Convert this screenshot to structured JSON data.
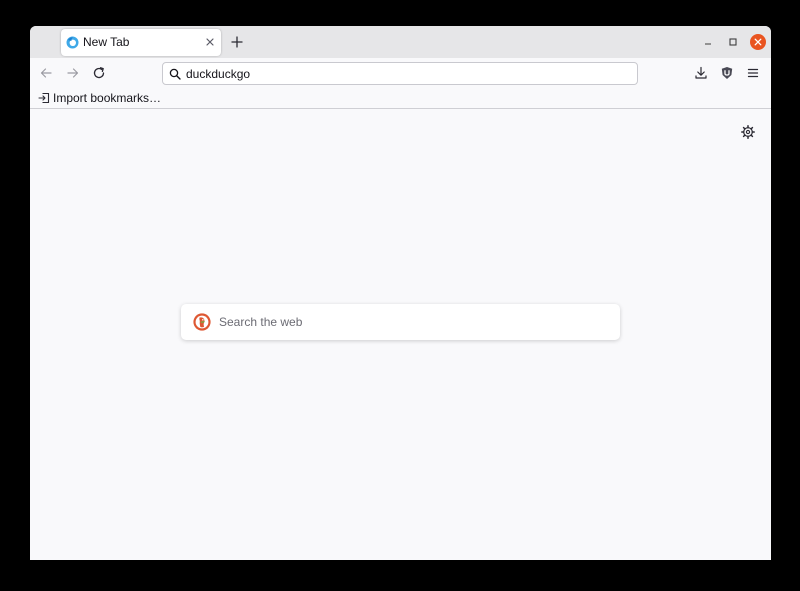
{
  "tab": {
    "title": "New Tab"
  },
  "urlbar": {
    "value": "duckduckgo"
  },
  "bookmarks": {
    "import_label": "Import bookmarks…"
  },
  "search": {
    "placeholder": "Search the web"
  },
  "icons": {
    "favicon": "firefox-icon",
    "tab_close": "close-icon",
    "new_tab": "plus-icon",
    "back": "arrow-left-icon",
    "forward": "arrow-right-icon",
    "reload": "reload-icon",
    "url_search": "search-icon",
    "download": "download-icon",
    "extension": "shield-icon",
    "menu": "hamburger-menu-icon",
    "import": "import-icon",
    "settings": "gear-icon",
    "search_engine": "duckduckgo-icon"
  },
  "colors": {
    "window_close": "#e95420",
    "duckduckgo": "#de5833",
    "content_bg": "#f9f9fb",
    "titlebar_bg": "#e6e6e8"
  }
}
